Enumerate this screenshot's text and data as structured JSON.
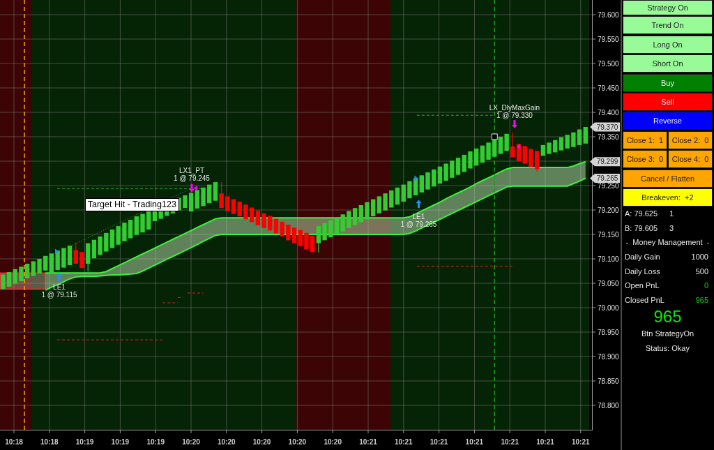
{
  "chart": {
    "price_axis": [
      "79.600",
      "79.550",
      "79.500",
      "79.450",
      "79.400",
      "79.350",
      "79.250",
      "79.200",
      "79.150",
      "79.100",
      "79.050",
      "79.000",
      "78.950",
      "78.900",
      "78.850",
      "78.800"
    ],
    "price_tags": [
      "79.370",
      "79.299",
      "79.265"
    ],
    "time_axis": [
      "10:18",
      "10:18",
      "10:19",
      "10:19",
      "10:19",
      "10:20",
      "10:20",
      "10:20",
      "10:20",
      "10:20",
      "10:21",
      "10:21",
      "10:21",
      "10:21",
      "10:21",
      "10:21",
      "10:21"
    ],
    "orders": [
      {
        "kind": "entry",
        "name": "LE1",
        "fill": "1 @ 79.115"
      },
      {
        "kind": "exit",
        "name": "LX1_PT",
        "fill": "1 @ 79.245"
      },
      {
        "kind": "entry",
        "name": "LE1",
        "fill": "1 @ 79.265"
      },
      {
        "kind": "exit",
        "name": "LX_DlyMaxGain",
        "fill": "1 @ 79.330"
      }
    ],
    "note": "Target Hit - Trading123"
  },
  "control_panel": {
    "buttons": [
      {
        "label": "Strategy On",
        "kind": "toggle",
        "on": true
      },
      {
        "label": "Trend On",
        "kind": "toggle",
        "on": true
      },
      {
        "label": "Long On",
        "kind": "toggle",
        "on": true
      },
      {
        "label": "Short On",
        "kind": "toggle",
        "on": true
      },
      {
        "label": "Buy",
        "kind": "buy"
      },
      {
        "label": "Sell",
        "kind": "sell"
      },
      {
        "label": "Reverse",
        "kind": "reverse"
      },
      {
        "label": "Close 1:  1",
        "kind": "close"
      },
      {
        "label": "Close 2:  0",
        "kind": "close"
      },
      {
        "label": "Close 3:  0",
        "kind": "close"
      },
      {
        "label": "Close 4:  0",
        "kind": "close"
      },
      {
        "label": "Cancel / Flatten",
        "kind": "flatten"
      },
      {
        "label": "Breakeven:  +2",
        "kind": "breakeven"
      }
    ],
    "quotes": [
      {
        "label": "A: 79.625",
        "size": "1"
      },
      {
        "label": "B: 79.605",
        "size": "3"
      }
    ],
    "section_title": "-  Money Management  -",
    "stats": [
      {
        "label": "Daily Gain",
        "value": "1000",
        "kind": "limit"
      },
      {
        "label": "Daily Loss",
        "value": "500",
        "kind": "limit"
      },
      {
        "label": "Open PnL",
        "value": "0",
        "kind": "pnl"
      },
      {
        "label": "Closed PnL",
        "value": "965",
        "kind": "pnl"
      }
    ],
    "total": "965",
    "last_action": "Btn StrategyOn",
    "status": "Status: Okay"
  }
}
